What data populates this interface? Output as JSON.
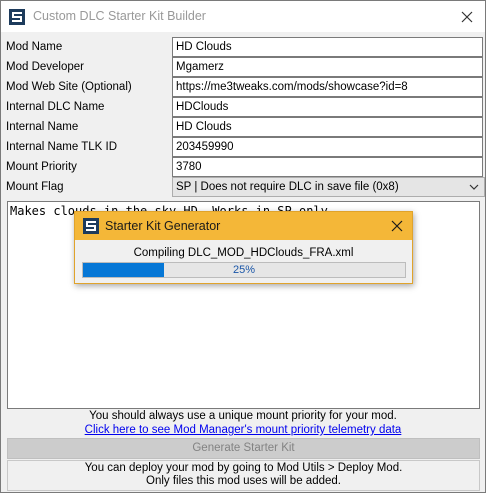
{
  "window": {
    "title": "Custom DLC Starter Kit Builder"
  },
  "form": {
    "fields": [
      {
        "label": "Mod Name",
        "value": "HD Clouds"
      },
      {
        "label": "Mod Developer",
        "value": "Mgamerz"
      },
      {
        "label": "Mod Web Site (Optional)",
        "value": "https://me3tweaks.com/mods/showcase?id=8"
      },
      {
        "label": "Internal DLC Name",
        "value": "HDClouds"
      },
      {
        "label": "Internal Name",
        "value": "HD Clouds"
      },
      {
        "label": "Internal Name TLK ID",
        "value": "203459990"
      },
      {
        "label": "Mount Priority",
        "value": "3780"
      }
    ],
    "mount_flag": {
      "label": "Mount Flag",
      "value": "SP | Does not require DLC in save file (0x8)"
    }
  },
  "description": {
    "value": "Makes clouds in the sky HD. Works in SP only."
  },
  "notes": {
    "priority_note": "You should always use a unique mount priority for your mod.",
    "telemetry_link": "Click here to see Mod Manager's mount priority telemetry data"
  },
  "generate_button": {
    "label": "Generate Starter Kit"
  },
  "deploy_info": {
    "line1": "You can deploy your mod by going to Mod Utils > Deploy Mod.",
    "line2": "Only files this mod uses will be added."
  },
  "dialog": {
    "title": "Starter Kit Generator",
    "message": "Compiling DLC_MOD_HDClouds_FRA.xml",
    "progress_text": "25%",
    "progress_value": 0.25
  },
  "icons": {
    "app": "me3tweaks-app-icon",
    "close": "close-icon",
    "dropdown": "chevron-down-icon"
  },
  "colors": {
    "dialog_title_bg": "#f4b738",
    "progress_fill": "#0677d6",
    "link": "#0000ee"
  }
}
